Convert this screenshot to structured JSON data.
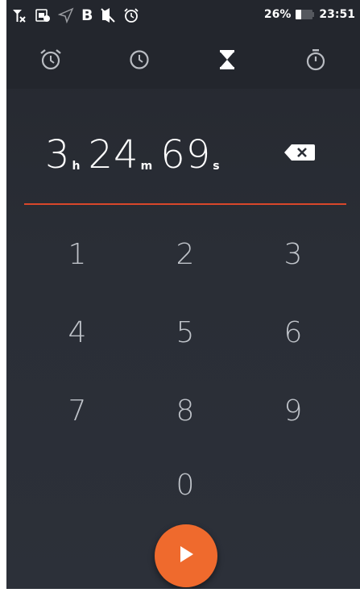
{
  "status_bar": {
    "battery_percent": "26%",
    "time": "23:51",
    "battery_level": 0.26,
    "icons": [
      "signal-off-icon",
      "notification-icon",
      "location-icon",
      "b-icon",
      "mute-icon",
      "alarm-icon"
    ],
    "b_letter": "B"
  },
  "tabs": [
    {
      "name": "alarm",
      "icon": "alarm-clock-icon",
      "selected": false
    },
    {
      "name": "clock",
      "icon": "clock-icon",
      "selected": false
    },
    {
      "name": "timer",
      "icon": "hourglass-icon",
      "selected": true
    },
    {
      "name": "stopwatch",
      "icon": "stopwatch-icon",
      "selected": false
    }
  ],
  "timer_entry": {
    "hours": "3",
    "hours_unit": "h",
    "minutes": "24",
    "minutes_unit": "m",
    "seconds": "69",
    "seconds_unit": "s",
    "backspace_icon": "backspace-icon"
  },
  "keypad": {
    "k1": "1",
    "k2": "2",
    "k3": "3",
    "k4": "4",
    "k5": "5",
    "k6": "6",
    "k7": "7",
    "k8": "8",
    "k9": "9",
    "k0": "0"
  },
  "fab": {
    "icon": "play-icon"
  },
  "colors": {
    "accent": "#ef6a2d",
    "underline": "#d9472b",
    "background": "#2a2e36",
    "keypad_text": "#bfc3c9"
  }
}
